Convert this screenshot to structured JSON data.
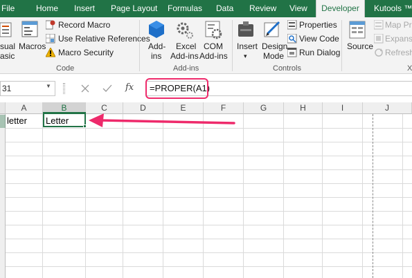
{
  "ribbon_tabs": {
    "file": "File",
    "home": "Home",
    "insert": "Insert",
    "page_layout": "Page Layout",
    "formulas": "Formulas",
    "data": "Data",
    "review": "Review",
    "view": "View",
    "developer": "Developer",
    "kutools": "Kutools ™"
  },
  "code_group": {
    "visual_basic_line1": "sual",
    "visual_basic_line2": "asic",
    "macros": "Macros",
    "record_macro": "Record Macro",
    "use_relative_references": "Use Relative References",
    "macro_security": "Macro Security",
    "label": "Code"
  },
  "addins_group": {
    "addins_line1": "Add-",
    "addins_line2": "ins",
    "excel_addins_line1": "Excel",
    "excel_addins_line2": "Add-ins",
    "com_addins_line1": "COM",
    "com_addins_line2": "Add-ins",
    "label": "Add-ins"
  },
  "controls_group": {
    "insert": "Insert",
    "design_mode_line1": "Design",
    "design_mode_line2": "Mode",
    "properties": "Properties",
    "view_code": "View Code",
    "run_dialog": "Run Dialog",
    "label": "Controls"
  },
  "xml_group": {
    "source": "Source",
    "map_properties": "Map Pro",
    "expansion_packs": "Expansio",
    "refresh_data": "Refresh",
    "label": "X"
  },
  "formula_bar": {
    "name_box": "31",
    "fx": "fx",
    "formula": "=PROPER(A1)"
  },
  "grid": {
    "columns": [
      "A",
      "B",
      "C",
      "D",
      "E",
      "F",
      "G",
      "H",
      "I",
      "J"
    ],
    "selected_column": "B",
    "cells": {
      "A1": "letter",
      "B1": "Letter"
    }
  },
  "colors": {
    "accent": "#217346",
    "highlight": "#ee2a6b"
  },
  "icons": [
    "visual-basic-icon",
    "macros-icon",
    "record-macro-icon",
    "relative-references-icon",
    "macro-security-icon",
    "addins-icon",
    "excel-addins-icon",
    "com-addins-icon",
    "insert-control-icon",
    "design-mode-icon",
    "properties-icon",
    "view-code-icon",
    "run-dialog-icon",
    "source-icon",
    "map-properties-icon",
    "expansion-packs-icon",
    "refresh-data-icon",
    "cancel-icon",
    "enter-icon",
    "fx-icon",
    "arrow-annotation"
  ]
}
